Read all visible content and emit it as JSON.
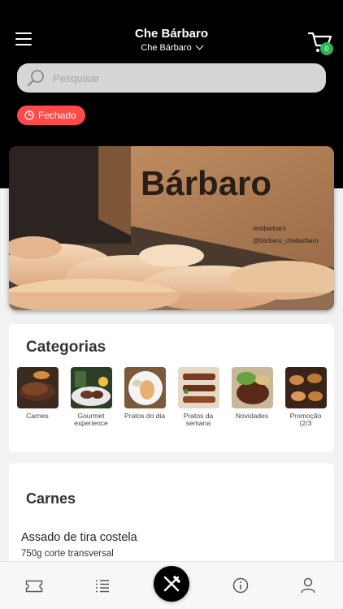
{
  "header": {
    "title": "Che Bárbaro",
    "store_selector": "Che Bárbaro",
    "cart_count": "0"
  },
  "search": {
    "placeholder": "Pesquisar"
  },
  "status": {
    "label": "Fechado"
  },
  "banner": {
    "brand": "Bárbaro",
    "social_1": "restbarbaro",
    "social_2": "@barbaro_chebarbaro"
  },
  "categories": {
    "title": "Categorias",
    "items": [
      {
        "label": "Carnes"
      },
      {
        "label": "Gourmet experience"
      },
      {
        "label": "Pratos do dia"
      },
      {
        "label": "Pratos da semana"
      },
      {
        "label": "Novidades"
      },
      {
        "label": "Promoção (2/3"
      }
    ]
  },
  "section": {
    "title": "Carnes",
    "item_name": "Assado de tira costela",
    "item_desc": "750g corte transversal"
  },
  "nav": {
    "items": [
      "ticket-icon",
      "list-icon",
      "cutlery-icon",
      "info-icon",
      "user-icon"
    ]
  },
  "colors": {
    "status_red": "#ff4a4a",
    "badge_green": "#2eb35a",
    "header_bg": "#000000"
  }
}
